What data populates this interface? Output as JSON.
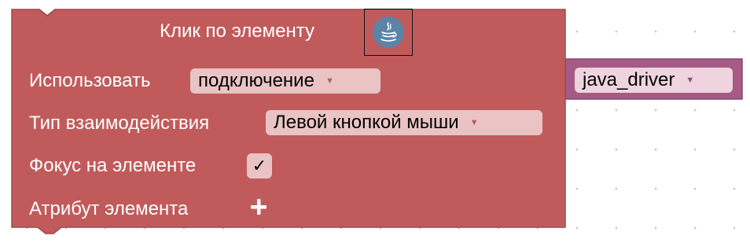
{
  "block": {
    "title": "Клик по элементу",
    "icon": "java-icon",
    "colors": {
      "block": "#c15b5b",
      "block_border": "#9c4a4a",
      "field": "#eac4c4",
      "driver_block": "#a65b84",
      "driver_field": "#efd4e0"
    },
    "rows": {
      "use_label": "Использовать",
      "use_value": "подключение",
      "interaction_label": "Тип взаимодействия",
      "interaction_value": "Левой кнопкой мыши",
      "focus_label": "Фокус на элементе",
      "focus_checked": true,
      "focus_mark": "✓",
      "attribute_label": "Атрибут элемента"
    }
  },
  "driver_block": {
    "value": "java_driver"
  }
}
